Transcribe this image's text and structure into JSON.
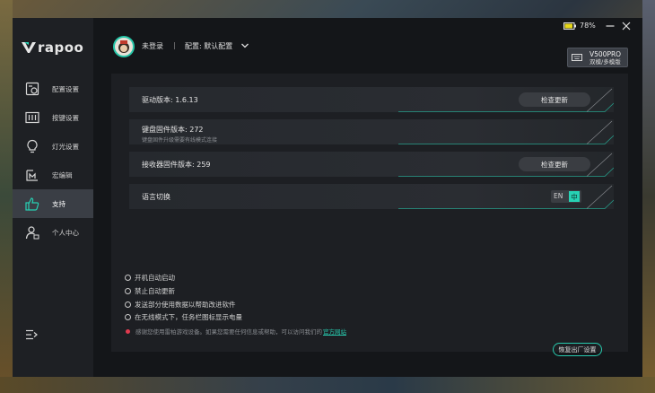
{
  "brand": {
    "name": "rapoo"
  },
  "sidebar": {
    "items": [
      {
        "label": "配置设置",
        "icon": "config-settings-icon"
      },
      {
        "label": "按键设置",
        "icon": "key-settings-icon"
      },
      {
        "label": "灯光设置",
        "icon": "lightbulb-icon"
      },
      {
        "label": "宏编辑",
        "icon": "macro-editor-icon"
      },
      {
        "label": "支持",
        "icon": "thumbs-up-icon",
        "active": true
      },
      {
        "label": "个人中心",
        "icon": "user-center-icon"
      }
    ]
  },
  "header": {
    "login": "未登录",
    "separator": "|",
    "profile": "配置: 默认配置",
    "battery": "78%",
    "device_name": "V500PRO",
    "device_mode": "双模/多模版"
  },
  "support": {
    "driver_label": "驱动版本: 1.6.13",
    "check_update": "检查更新",
    "keyboard_fw_label": "键盘固件版本: 272",
    "keyboard_fw_note": "键盘固件升级需要有线模式连接",
    "receiver_fw_label": "接收器固件版本: 259",
    "lang_label": "语言切换",
    "lang_en": "EN",
    "lang_zh": "中"
  },
  "options": {
    "autostart": "开机自动启动",
    "disable_autoupdate": "禁止自动更新",
    "send_data": "发送部分使用数据以帮助改进软件",
    "tray_battery": "在无线模式下，任务栏图标显示电量",
    "note_text": "感谢您使用雷柏游戏设备。如果您需要任何信息或帮助，可以访问我们的",
    "note_link": "官方网站",
    "reset": "恢复出厂设置"
  },
  "colors": {
    "accent": "#27d2b4",
    "sidebar_bg": "#1e2024",
    "panel_bg": "#1d1f23",
    "battery": "#e8d81a"
  }
}
